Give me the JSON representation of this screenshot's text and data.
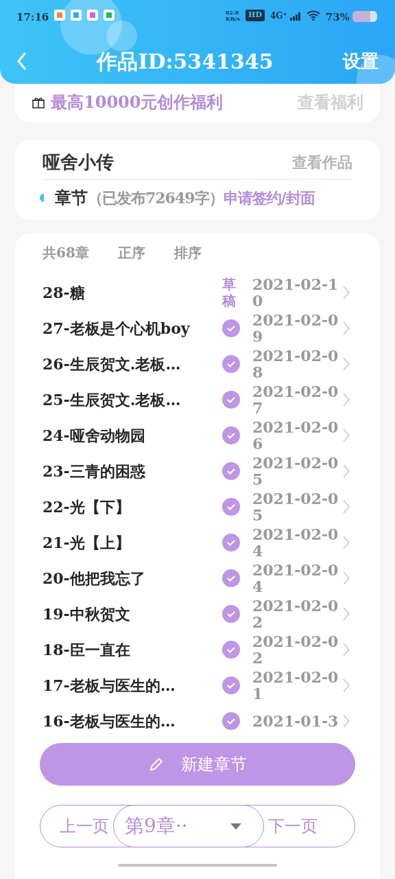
{
  "status_bar": {
    "time": "17:16",
    "speed": "82.8",
    "speed_unit": "KB/s",
    "hd": "HD",
    "network": "4G⁺",
    "battery": "73%"
  },
  "header": {
    "title": "作品ID:5341345",
    "action": "设置"
  },
  "benefit": {
    "text": "最高10000元创作福利",
    "link": "查看福利"
  },
  "work": {
    "title": "哑舍小传",
    "link": "查看作品",
    "section": "章节",
    "count": "（已发布72649字）",
    "apply": "申请签约/封面"
  },
  "list_header": {
    "total": "共68章",
    "order": "正序",
    "sort": "排序"
  },
  "chapters": [
    {
      "title": "28-糖",
      "kind": "draft",
      "draft_label": "草稿",
      "date": "2021-02-10"
    },
    {
      "title": "27-老板是个心机boy",
      "kind": "published",
      "date": "2021-02-09"
    },
    {
      "title": "26-生辰贺文.老板…",
      "kind": "published",
      "date": "2021-02-08"
    },
    {
      "title": "25-生辰贺文.老板…",
      "kind": "published",
      "date": "2021-02-07"
    },
    {
      "title": "24-哑舍动物园",
      "kind": "published",
      "date": "2021-02-06"
    },
    {
      "title": "23-三青的困惑",
      "kind": "published",
      "date": "2021-02-05"
    },
    {
      "title": "22-光【下】",
      "kind": "published",
      "date": "2021-02-05"
    },
    {
      "title": "21-光【上】",
      "kind": "published",
      "date": "2021-02-04"
    },
    {
      "title": "20-他把我忘了",
      "kind": "published",
      "date": "2021-02-04"
    },
    {
      "title": "19-中秋贺文",
      "kind": "published",
      "date": "2021-02-02"
    },
    {
      "title": "18-臣一直在",
      "kind": "published",
      "date": "2021-02-02"
    },
    {
      "title": "17-老板与医生的…",
      "kind": "published",
      "date": "2021-02-01"
    },
    {
      "title": "16-老板与医生的…",
      "kind": "published",
      "date": "2021-01-3"
    }
  ],
  "new_button": "新建章节",
  "pager": {
    "prev": "上一页",
    "current": "第9章··",
    "next": "下一页"
  }
}
